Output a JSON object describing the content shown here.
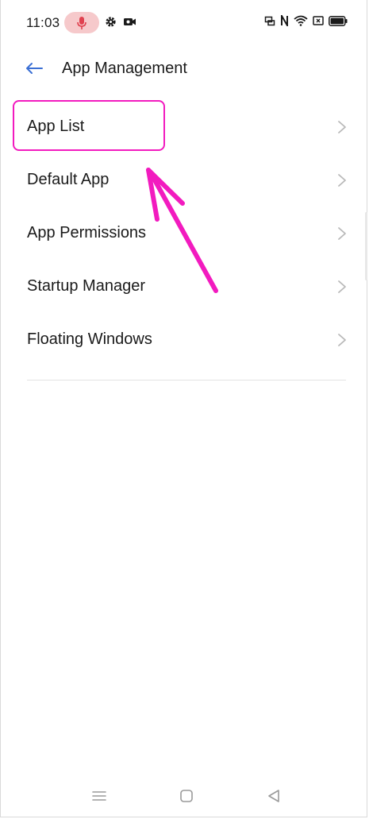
{
  "status_bar": {
    "time": "11:03",
    "icons_left": [
      "mic-icon",
      "gear-icon",
      "camera-icon"
    ],
    "icons_right": [
      "cast-icon",
      "nfc-icon",
      "wifi-icon",
      "close-box-icon",
      "battery-icon"
    ]
  },
  "header": {
    "title": "App Management",
    "back_icon": "back-arrow-icon"
  },
  "menu": {
    "items": [
      {
        "label": "App List"
      },
      {
        "label": "Default App"
      },
      {
        "label": "App Permissions"
      },
      {
        "label": "Startup Manager"
      },
      {
        "label": "Floating Windows"
      }
    ]
  },
  "navigation": {
    "buttons": [
      "menu-icon",
      "home-icon",
      "back-icon"
    ]
  },
  "colors": {
    "accent": "#3b6fd4",
    "annotation": "#f21bbf",
    "mic_pill": "#f6c9cb",
    "mic": "#e0414f"
  }
}
